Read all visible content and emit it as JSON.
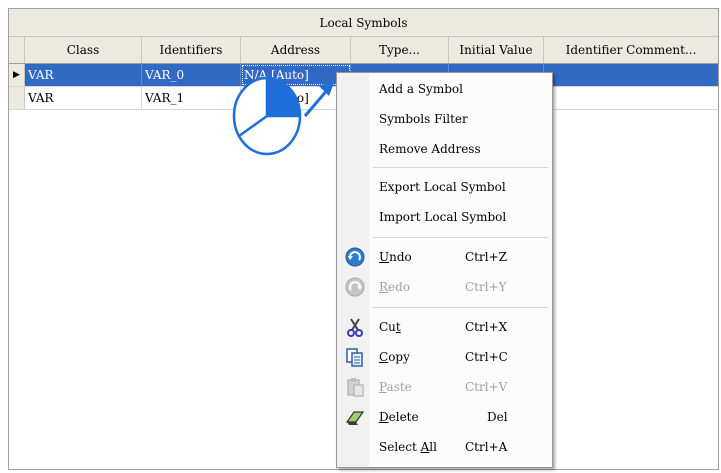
{
  "table": {
    "group_title": "Local Symbols",
    "columns": [
      "Class",
      "Identifiers",
      "Address",
      "Type...",
      "Initial Value",
      "Identifier Comment..."
    ],
    "rows": [
      {
        "selected": true,
        "indicator": "▶",
        "class": "VAR",
        "identifier": "VAR_0",
        "address": "N/A [Auto]",
        "type": "",
        "initial": "",
        "comment": ""
      },
      {
        "selected": false,
        "indicator": "",
        "class": "VAR",
        "identifier": "VAR_1",
        "address": "N/A [Auto]",
        "type": "",
        "initial": "",
        "comment": ""
      }
    ]
  },
  "context_menu": {
    "add_symbol": "Add a Symbol",
    "symbols_filter": "Symbols Filter",
    "remove_address": "Remove Address",
    "export_local": "Export Local Symbol",
    "import_local": "Import Local Symbol",
    "undo": {
      "label": "Undo",
      "mnemonic": "U",
      "rest": "ndo",
      "shortcut": "Ctrl+Z",
      "icon": "undo-icon"
    },
    "redo": {
      "label": "Redo",
      "mnemonic": "R",
      "rest": "edo",
      "shortcut": "Ctrl+Y",
      "icon": "redo-icon",
      "disabled": true
    },
    "cut": {
      "label": "Cut",
      "pre": "Cu",
      "mnemonic": "t",
      "shortcut": "Ctrl+X",
      "icon": "scissors-icon"
    },
    "copy": {
      "label": "Copy",
      "mnemonic": "C",
      "rest": "opy",
      "shortcut": "Ctrl+C",
      "icon": "copy-icon"
    },
    "paste": {
      "label": "Paste",
      "mnemonic": "P",
      "rest": "aste",
      "shortcut": "Ctrl+V",
      "icon": "paste-icon",
      "disabled": true
    },
    "delete": {
      "label": "Delete",
      "mnemonic": "D",
      "rest": "elete",
      "shortcut": "Del",
      "icon": "eraser-icon"
    },
    "select_all": {
      "label": "Select All",
      "pre": "Select ",
      "mnemonic": "A",
      "rest": "ll",
      "shortcut": "Ctrl+A"
    }
  },
  "colors": {
    "selection": "#316ac5",
    "accent": "#1e6fd9",
    "header_bg": "#eceae0"
  }
}
